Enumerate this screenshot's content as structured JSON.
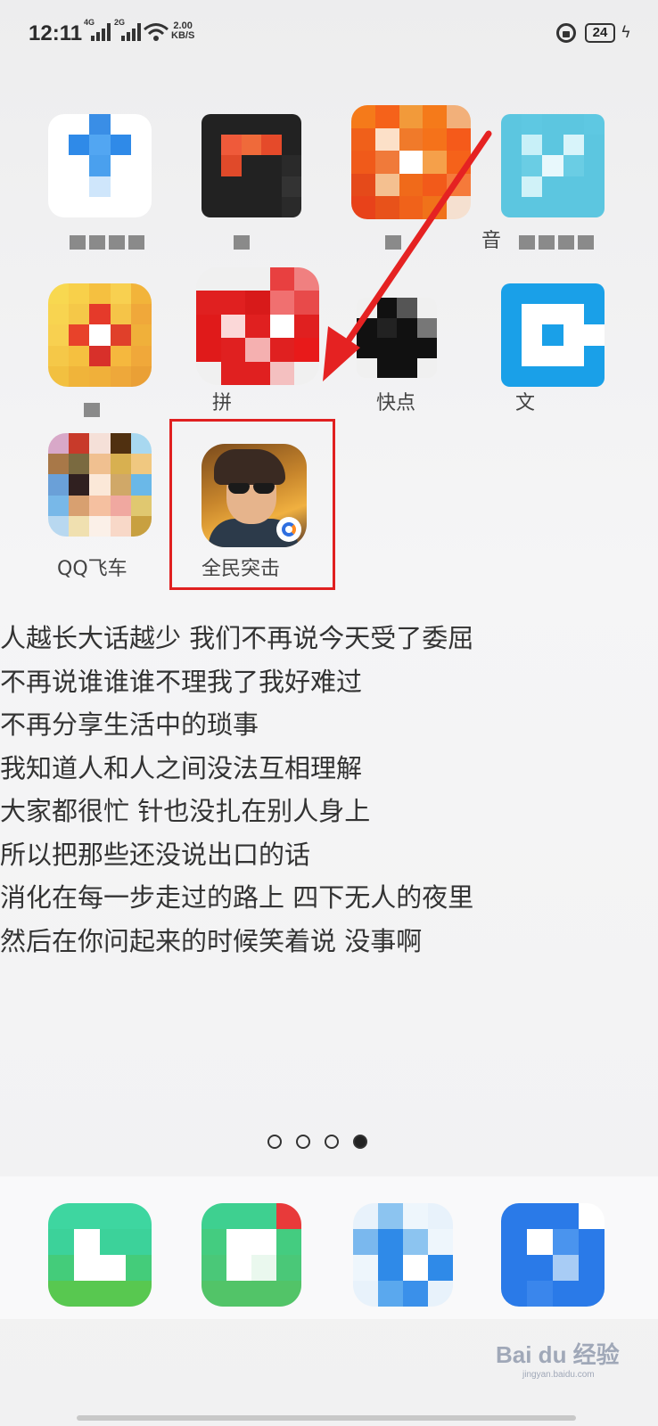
{
  "status_bar": {
    "time": "12:11",
    "signal1_label": "4G",
    "signal2_label": "2G",
    "net_speed": "2.00",
    "net_unit": "KB/S",
    "battery": "24"
  },
  "apps": {
    "row1": [
      {
        "label": "",
        "icon": "pixelated-app-icon"
      },
      {
        "label": "",
        "icon": "pixelated-app-icon"
      },
      {
        "label": "",
        "icon": "pixelated-app-icon"
      },
      {
        "label": "音",
        "icon": "pixelated-app-icon"
      }
    ],
    "row2": [
      {
        "label": "",
        "icon": "pixelated-app-icon"
      },
      {
        "label": "拼",
        "icon": "pixelated-app-icon"
      },
      {
        "label": "快点",
        "icon": "pixelated-app-icon"
      },
      {
        "label": "文",
        "icon": "pixelated-app-icon"
      }
    ],
    "row3": [
      {
        "label": "QQ飞车",
        "icon": "pixelated-app-icon"
      },
      {
        "label": "全民突击",
        "icon": "game-app-icon"
      }
    ]
  },
  "lyrics": [
    "人越长大话越少 我们不再说今天受了委屈",
    "不再说谁谁谁不理我了我好难过",
    "不再分享生活中的琐事",
    "我知道人和人之间没法互相理解",
    "大家都很忙 针也没扎在别人身上",
    "所以把那些还没说出口的话",
    "消化在每一步走过的路上 四下无人的夜里",
    "然后在你问起来的时候笑着说 没事啊"
  ],
  "page_indicator": {
    "total": 4,
    "active": 4
  },
  "watermark": {
    "brand": "Bai du 经验",
    "url": "jingyan.baidu.com"
  },
  "colors": {
    "highlight": "#e02020",
    "arrow": "#e52222"
  }
}
